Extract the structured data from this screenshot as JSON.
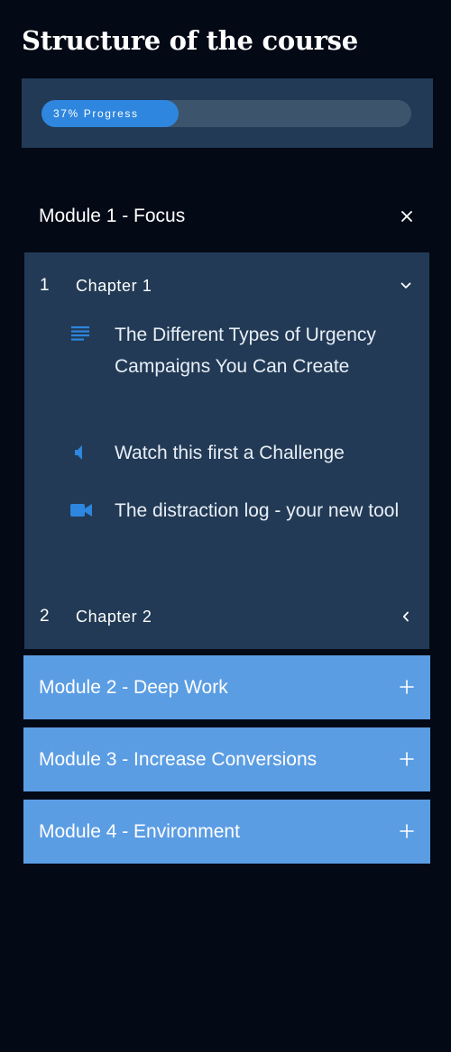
{
  "page": {
    "title": "Structure of the course"
  },
  "progress": {
    "label": "37% Progress",
    "fraction": 0.37,
    "fill_color": "#2e86de",
    "track_color": "#3d546d"
  },
  "modules": [
    {
      "label": "Module 1 - Focus",
      "state": "expanded",
      "toggle_icon": "close-icon",
      "chapters": [
        {
          "number": "1",
          "label": "Chapter 1",
          "toggle_icon": "chevron-down-icon",
          "lessons": [
            {
              "icon": "text-lines-icon",
              "title": "The Different Types of Urgency Campaigns You Can Create"
            },
            {
              "icon": "speaker-icon",
              "title": "Watch this first a Challenge"
            },
            {
              "icon": "video-camera-icon",
              "title": "The distraction log - your new tool"
            }
          ]
        },
        {
          "number": "2",
          "label": "Chapter 2",
          "toggle_icon": "chevron-left-icon"
        }
      ]
    },
    {
      "label": "Module 2 - Deep Work",
      "state": "collapsed",
      "toggle_icon": "plus-icon"
    },
    {
      "label": "Module 3 - Increase Conversions",
      "state": "collapsed",
      "toggle_icon": "plus-icon"
    },
    {
      "label": "Module 4 - Environment",
      "state": "collapsed",
      "toggle_icon": "plus-icon"
    }
  ],
  "colors": {
    "background": "#040916",
    "panel": "#223a55",
    "module_bar": "#5b9de3",
    "accent": "#2e86de"
  }
}
